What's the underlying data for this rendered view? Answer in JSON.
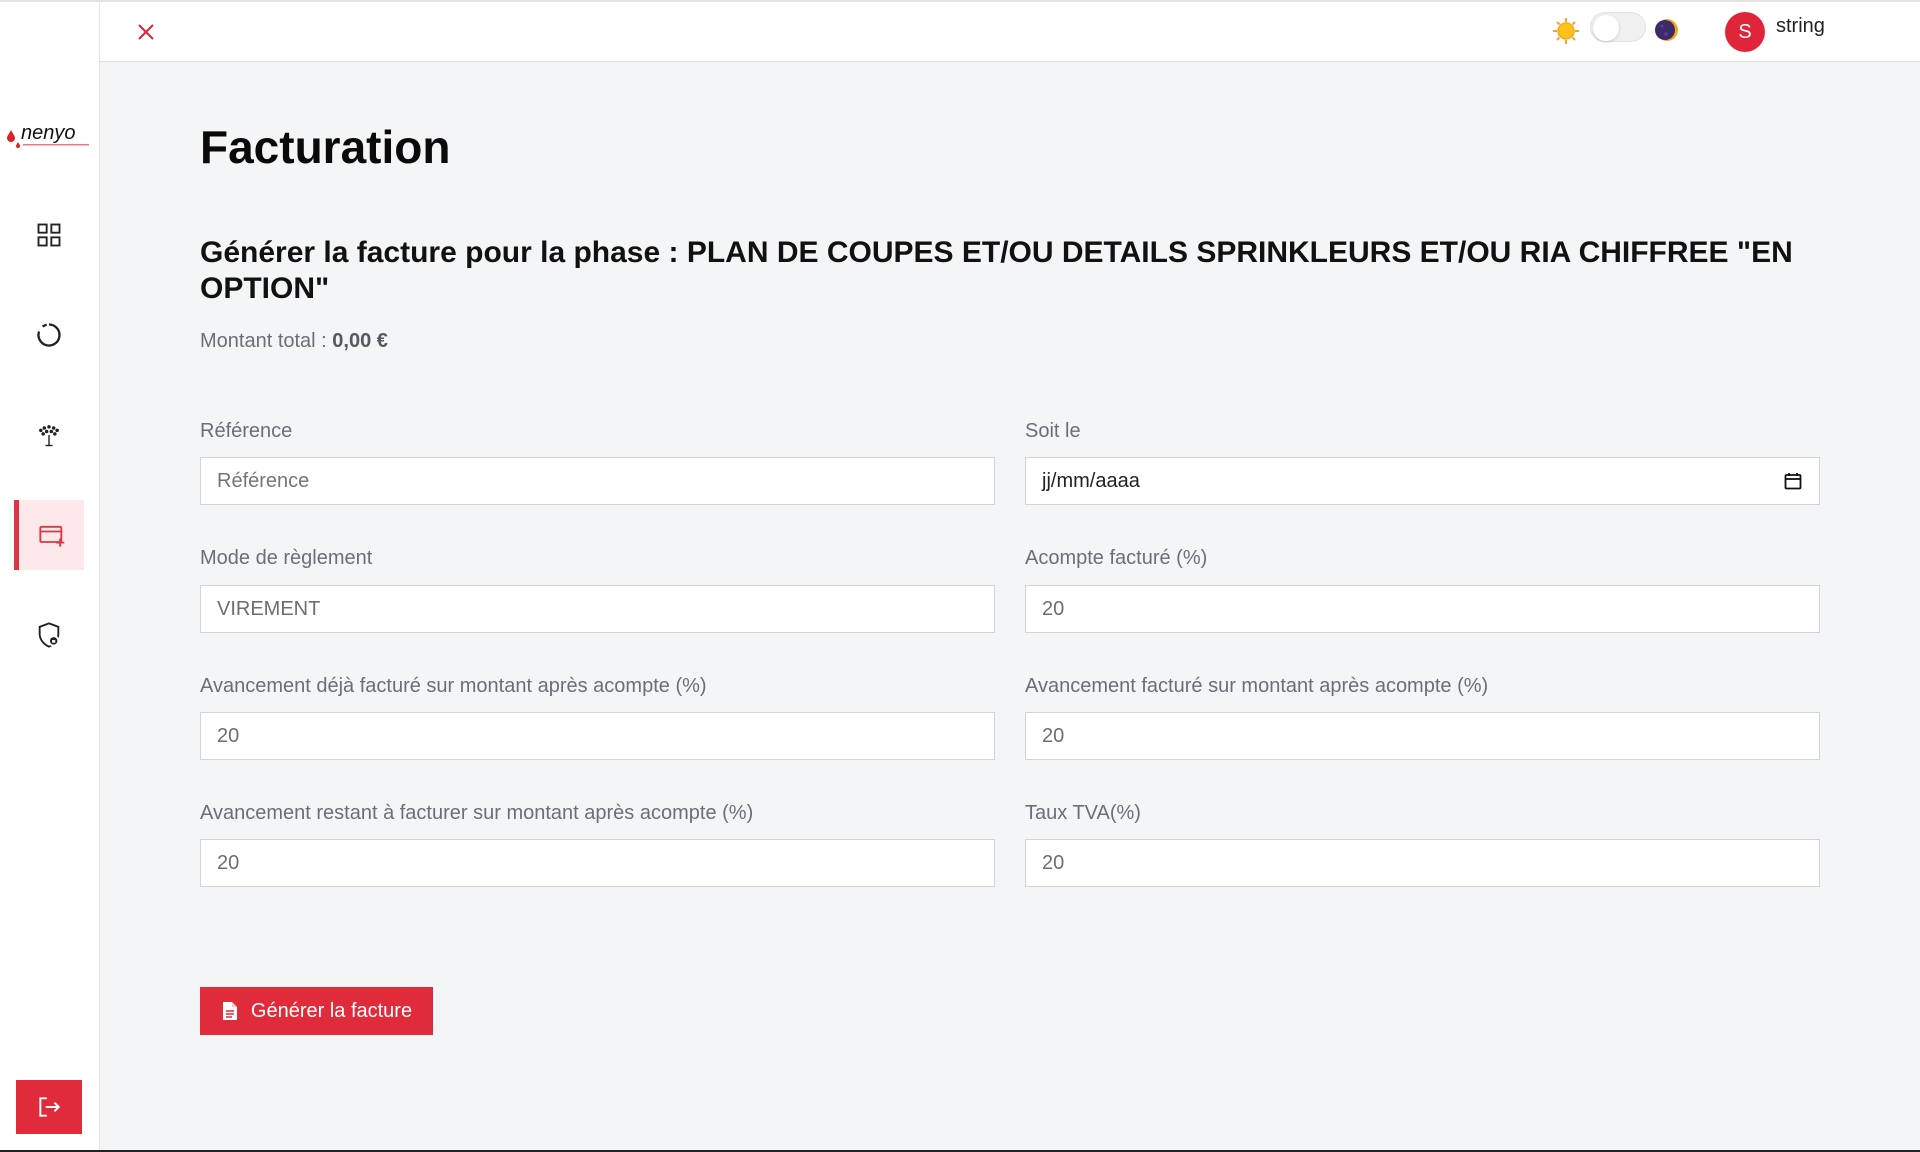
{
  "brand": {
    "logo_text": "nenyo",
    "accent": "#dc3545"
  },
  "sidebar": {
    "items": [
      {
        "icon": "grid-icon",
        "active": false
      },
      {
        "icon": "circle-progress-icon",
        "active": false
      },
      {
        "icon": "sprinkler-icon",
        "active": false
      },
      {
        "icon": "credit-card-plus-icon",
        "active": true
      },
      {
        "icon": "shield-lock-icon",
        "active": false
      }
    ],
    "logout_icon": "logout-icon"
  },
  "topbar": {
    "close_icon": "close-icon",
    "theme_light_icon": "sun-icon",
    "theme_dark_icon": "moon-icon",
    "avatar_initial": "S",
    "username": "string"
  },
  "page": {
    "title": "Facturation",
    "subtitle": "Générer la facture pour la phase : PLAN DE COUPES ET/OU DETAILS SPRINKLEURS ET/OU RIA CHIFFREE \"EN OPTION\"",
    "total_label": "Montant total : ",
    "total_value": "0,00 €"
  },
  "form": {
    "reference": {
      "label": "Référence",
      "placeholder": "Référence",
      "value": ""
    },
    "date": {
      "label": "Soit le",
      "value": "jj/mm/aaaa"
    },
    "payment_mode": {
      "label": "Mode de règlement",
      "value": "VIREMENT"
    },
    "deposit": {
      "label": "Acompte facturé (%)",
      "value": "20"
    },
    "progress_already": {
      "label": "Avancement déjà facturé sur montant après acompte (%)",
      "value": "20"
    },
    "progress_billed": {
      "label": "Avancement facturé sur montant après acompte (%)",
      "value": "20"
    },
    "progress_remaining": {
      "label": "Avancement restant à facturer sur montant après acompte (%)",
      "value": "20"
    },
    "vat_rate": {
      "label": "Taux TVA(%)",
      "value": "20"
    }
  },
  "actions": {
    "generate_label": "Générer la facture",
    "generate_icon": "document-icon"
  }
}
